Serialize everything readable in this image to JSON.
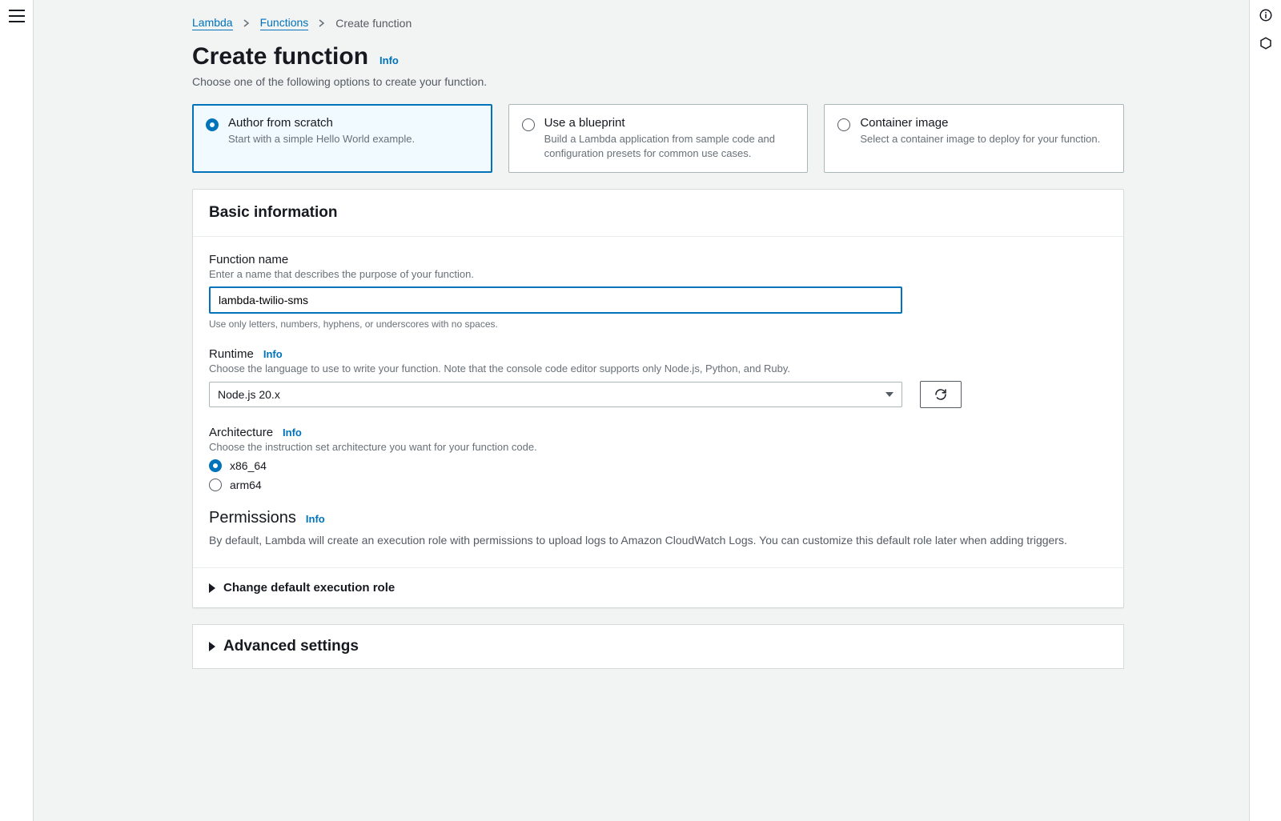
{
  "breadcrumb": {
    "service": "Lambda",
    "functions": "Functions",
    "current": "Create function"
  },
  "page": {
    "title": "Create function",
    "info": "Info",
    "subtitle": "Choose one of the following options to create your function."
  },
  "options": [
    {
      "title": "Author from scratch",
      "desc": "Start with a simple Hello World example.",
      "selected": true
    },
    {
      "title": "Use a blueprint",
      "desc": "Build a Lambda application from sample code and configuration presets for common use cases.",
      "selected": false
    },
    {
      "title": "Container image",
      "desc": "Select a container image to deploy for your function.",
      "selected": false
    }
  ],
  "basic": {
    "heading": "Basic information",
    "functionName": {
      "label": "Function name",
      "hint": "Enter a name that describes the purpose of your function.",
      "value": "lambda-twilio-sms",
      "constraint": "Use only letters, numbers, hyphens, or underscores with no spaces."
    },
    "runtime": {
      "label": "Runtime",
      "info": "Info",
      "hint": "Choose the language to use to write your function. Note that the console code editor supports only Node.js, Python, and Ruby.",
      "value": "Node.js 20.x"
    },
    "architecture": {
      "label": "Architecture",
      "info": "Info",
      "hint": "Choose the instruction set architecture you want for your function code.",
      "options": [
        "x86_64",
        "arm64"
      ],
      "selected": "x86_64"
    },
    "permissions": {
      "label": "Permissions",
      "info": "Info",
      "desc": "By default, Lambda will create an execution role with permissions to upload logs to Amazon CloudWatch Logs. You can customize this default role later when adding triggers."
    },
    "changeRole": "Change default execution role"
  },
  "advanced": "Advanced settings"
}
